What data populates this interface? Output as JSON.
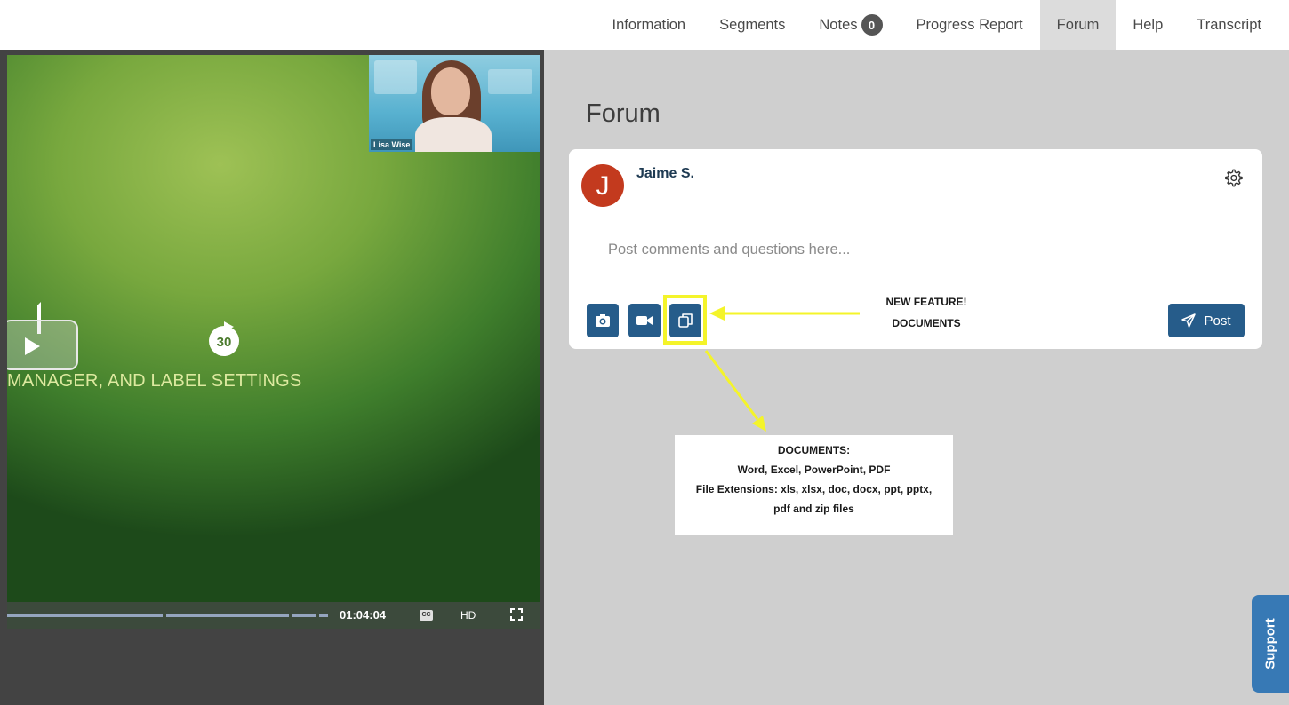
{
  "nav": {
    "tabs": [
      {
        "label": "Information"
      },
      {
        "label": "Segments"
      },
      {
        "label": "Notes",
        "badge": "0"
      },
      {
        "label": "Progress Report"
      },
      {
        "label": "Forum",
        "active": true
      },
      {
        "label": "Help"
      },
      {
        "label": "Transcript"
      }
    ]
  },
  "video": {
    "slide_text": "MANAGER, AND LABEL SETTINGS",
    "presenter_name": "Lisa Wise",
    "skip_seconds": "30",
    "time": "01:04:04",
    "cc_label": "CC",
    "hd_label": "HD",
    "icons": [
      "play-icon",
      "skip-forward-icon",
      "fullscreen-icon"
    ]
  },
  "forum": {
    "title": "Forum",
    "user_initial": "J",
    "user_name": "Jaime S.",
    "comment_placeholder": "Post comments and questions here...",
    "post_label": "Post",
    "annotation_line1": "NEW FEATURE!",
    "annotation_line2": "DOCUMENTS",
    "doc_info": {
      "heading": "DOCUMENTS:",
      "types": "Word, Excel, PowerPoint, PDF",
      "extensions": "File Extensions: xls, xlsx, doc, docx, ppt, pptx,",
      "extensions_tail": "pdf and zip files"
    },
    "icons": [
      "gear-icon",
      "camera-icon",
      "video-camera-icon",
      "copy-document-icon",
      "paper-plane-icon"
    ]
  },
  "support": {
    "label": "Support"
  },
  "colors": {
    "accent": "#265c8a",
    "highlight": "#f4f42a",
    "avatar": "#c33a1e",
    "support": "#3779b5"
  }
}
